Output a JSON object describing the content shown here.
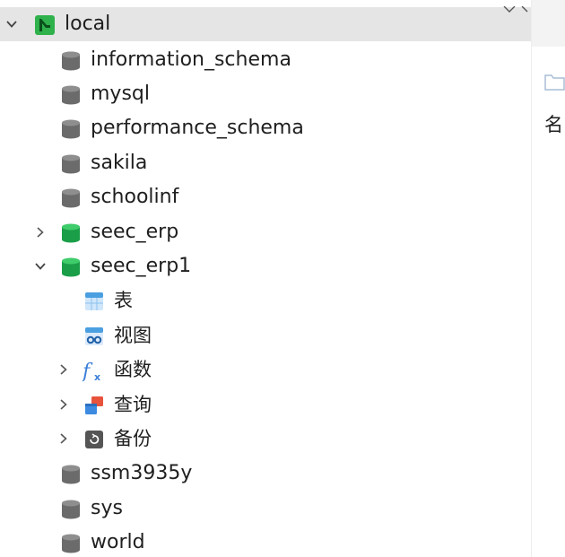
{
  "tree": {
    "connection": {
      "label": "local",
      "expanded": true,
      "selected": true
    },
    "databases": [
      {
        "label": "information_schema",
        "state": "closed",
        "expandable": false
      },
      {
        "label": "mysql",
        "state": "closed",
        "expandable": false
      },
      {
        "label": "performance_schema",
        "state": "closed",
        "expandable": false
      },
      {
        "label": "sakila",
        "state": "closed",
        "expandable": false
      },
      {
        "label": "schoolinf",
        "state": "closed",
        "expandable": false
      },
      {
        "label": "seec_erp",
        "state": "open",
        "expandable": true,
        "expanded": false
      },
      {
        "label": "seec_erp1",
        "state": "open",
        "expandable": true,
        "expanded": true,
        "children": [
          {
            "label": "表",
            "icon": "table-icon",
            "expandable": false
          },
          {
            "label": "视图",
            "icon": "view-icon",
            "expandable": false
          },
          {
            "label": "函数",
            "icon": "function-icon",
            "expandable": true
          },
          {
            "label": "查询",
            "icon": "query-icon",
            "expandable": true
          },
          {
            "label": "备份",
            "icon": "backup-icon",
            "expandable": true
          }
        ]
      },
      {
        "label": "ssm3935y",
        "state": "closed",
        "expandable": false
      },
      {
        "label": "sys",
        "state": "closed",
        "expandable": false
      },
      {
        "label": "world",
        "state": "closed",
        "expandable": false
      }
    ]
  },
  "right_panel": {
    "column_header": "名"
  },
  "colors": {
    "selected_row": "#e5e5e5",
    "db_closed": "#6b6b6b",
    "db_open": "#1db954",
    "connection_icon": "#2fb14b",
    "table_icon": "#4a9fe0",
    "function_icon": "#3b7fd9",
    "query_icon_red": "#e8533c",
    "query_icon_blue": "#3d8be0",
    "backup_icon": "#555555"
  }
}
